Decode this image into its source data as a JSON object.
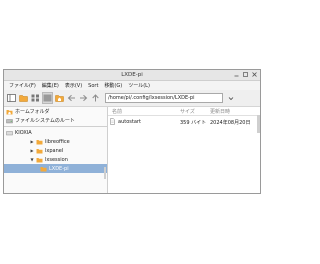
{
  "window": {
    "title": "LXDE-pi"
  },
  "menu": [
    "ファイル(F)",
    "編集(E)",
    "表示(V)",
    "Sort",
    "移動(G)",
    "ツール(L)"
  ],
  "toolbar": {
    "path": "/home/pi/.config/lxsession/LXDE-pi"
  },
  "places": [
    {
      "label": "ホームフォルダ",
      "icon": "home-folder-icon"
    },
    {
      "label": "ファイルシステムのルート",
      "icon": "drive-icon"
    }
  ],
  "drive": {
    "label": "KIOXIA"
  },
  "tree": [
    {
      "label": "libreoffice",
      "expanded": false
    },
    {
      "label": "lxpanel",
      "expanded": false
    },
    {
      "label": "lxsession",
      "expanded": true
    },
    {
      "label": "LXDE-pi",
      "selected": true
    }
  ],
  "columns": {
    "name": "名前",
    "size": "サイズ",
    "modified": "更新日時"
  },
  "files": [
    {
      "name": "autostart",
      "size": "359 バイト",
      "modified": "2024年08月20日"
    }
  ],
  "colors": {
    "selection": "#8fb1d8",
    "folder": "#f2a93b",
    "window_border": "#9a9a9a"
  }
}
